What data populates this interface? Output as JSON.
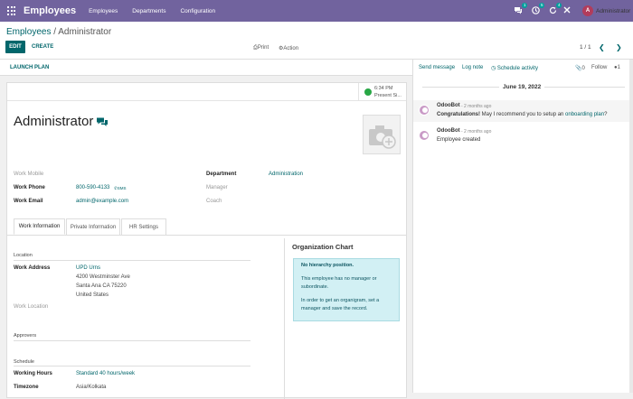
{
  "topbar": {
    "app_title": "Employees",
    "nav": [
      "Employees",
      "Departments",
      "Configuration"
    ],
    "chat_count": "1",
    "activity_count": "5",
    "refresh_count": "4",
    "user_initial": "A",
    "user_name": "Administrator"
  },
  "control_panel": {
    "breadcrumb_parent": "Employees",
    "breadcrumb_sep": " / ",
    "breadcrumb_current": "Administrator",
    "edit": "EDIT",
    "create": "CREATE",
    "print": "Print",
    "action": "Action",
    "pager": "1 / 1"
  },
  "form": {
    "launch_plan": "LAUNCH PLAN",
    "presence_time": "6:34 PM",
    "presence_status": "Present Si...",
    "employee_name": "Administrator",
    "fields": {
      "work_mobile_label": "Work Mobile",
      "work_phone_label": "Work Phone",
      "work_phone": "800-590-4133",
      "sms": "SMS",
      "work_email_label": "Work Email",
      "work_email": "admin@example.com",
      "department_label": "Department",
      "department": "Administration",
      "manager_label": "Manager",
      "coach_label": "Coach"
    },
    "tabs": [
      "Work Information",
      "Private Information",
      "HR Settings"
    ],
    "work_info": {
      "location_section": "Location",
      "work_address_label": "Work Address",
      "address": [
        "UPD Urns",
        "4200 Westminster Ave",
        "Santa Ana CA 75220",
        "United States"
      ],
      "work_location_label": "Work Location",
      "approvers_section": "Approvers",
      "schedule_section": "Schedule",
      "working_hours_label": "Working Hours",
      "working_hours": "Standard 40 hours/week",
      "timezone_label": "Timezone",
      "timezone": "Asia/Kolkata"
    },
    "org_chart": {
      "title": "Organization Chart",
      "heading": "No hierarchy position.",
      "line1": "This employee has no manager or",
      "line2": "subordinate.",
      "line3": "In order to get an organigram, set a",
      "line4": "manager and save the record."
    }
  },
  "chatter": {
    "send_message": "Send message",
    "log_note": "Log note",
    "schedule_activity": "Schedule activity",
    "attachments": "0",
    "follow": "Follow",
    "followers": "1",
    "date": "June 19, 2022",
    "messages": [
      {
        "author": "OdooBot",
        "ago": "- 2 months ago",
        "bold": "Congratulations!",
        "text": " May I recommend you to setup an ",
        "link": "onboarding plan",
        "tail": "?"
      },
      {
        "author": "OdooBot",
        "ago": "- 2 months ago",
        "text": "Employee created"
      }
    ]
  },
  "colors": {
    "topbar": "#71639e",
    "primary": "#01666b",
    "presence": "#28a745"
  }
}
